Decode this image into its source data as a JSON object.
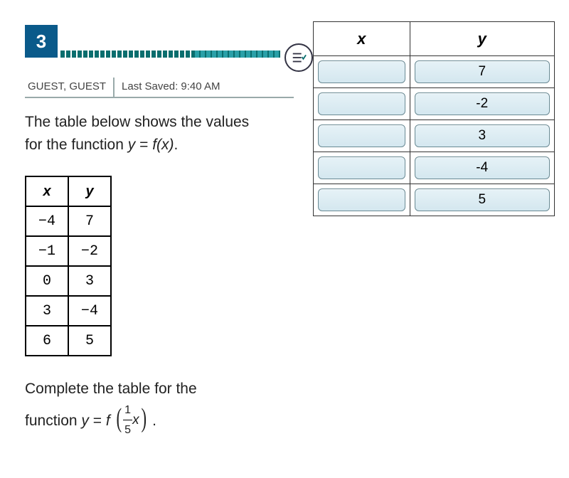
{
  "question_number": "3",
  "user_name": "GUEST, GUEST",
  "last_saved_label": "Last Saved: 9:40 AM",
  "question_text_line1": "The table below shows the values",
  "question_text_line2_prefix": "for the function ",
  "question_text_line2_eq_y": "y",
  "question_text_line2_eq_mid": " = ",
  "question_text_line2_eq_fx": "f(x)",
  "question_text_line2_eq_suffix": ".",
  "src_table": {
    "headers": {
      "x": "x",
      "y": "y"
    },
    "rows": [
      {
        "x": "−4",
        "y": "7"
      },
      {
        "x": "−1",
        "y": "−2"
      },
      {
        "x": "0",
        "y": "3"
      },
      {
        "x": "3",
        "y": "−4"
      },
      {
        "x": "6",
        "y": "5"
      }
    ]
  },
  "complete_line1": "Complete the table for the",
  "complete_line2_prefix": "function ",
  "complete_line2_y": "y",
  "complete_line2_eq": " = ",
  "complete_line2_f": "f",
  "complete_line2_frac_num": "1",
  "complete_line2_frac_den": "5",
  "complete_line2_xvar": "x",
  "complete_line2_suffix": " .",
  "answer_table": {
    "headers": {
      "x": "x",
      "y": "y"
    },
    "rows": [
      {
        "x": "",
        "y": "7"
      },
      {
        "x": "",
        "y": "-2"
      },
      {
        "x": "",
        "y": "3"
      },
      {
        "x": "",
        "y": "-4"
      },
      {
        "x": "",
        "y": "5"
      }
    ]
  }
}
